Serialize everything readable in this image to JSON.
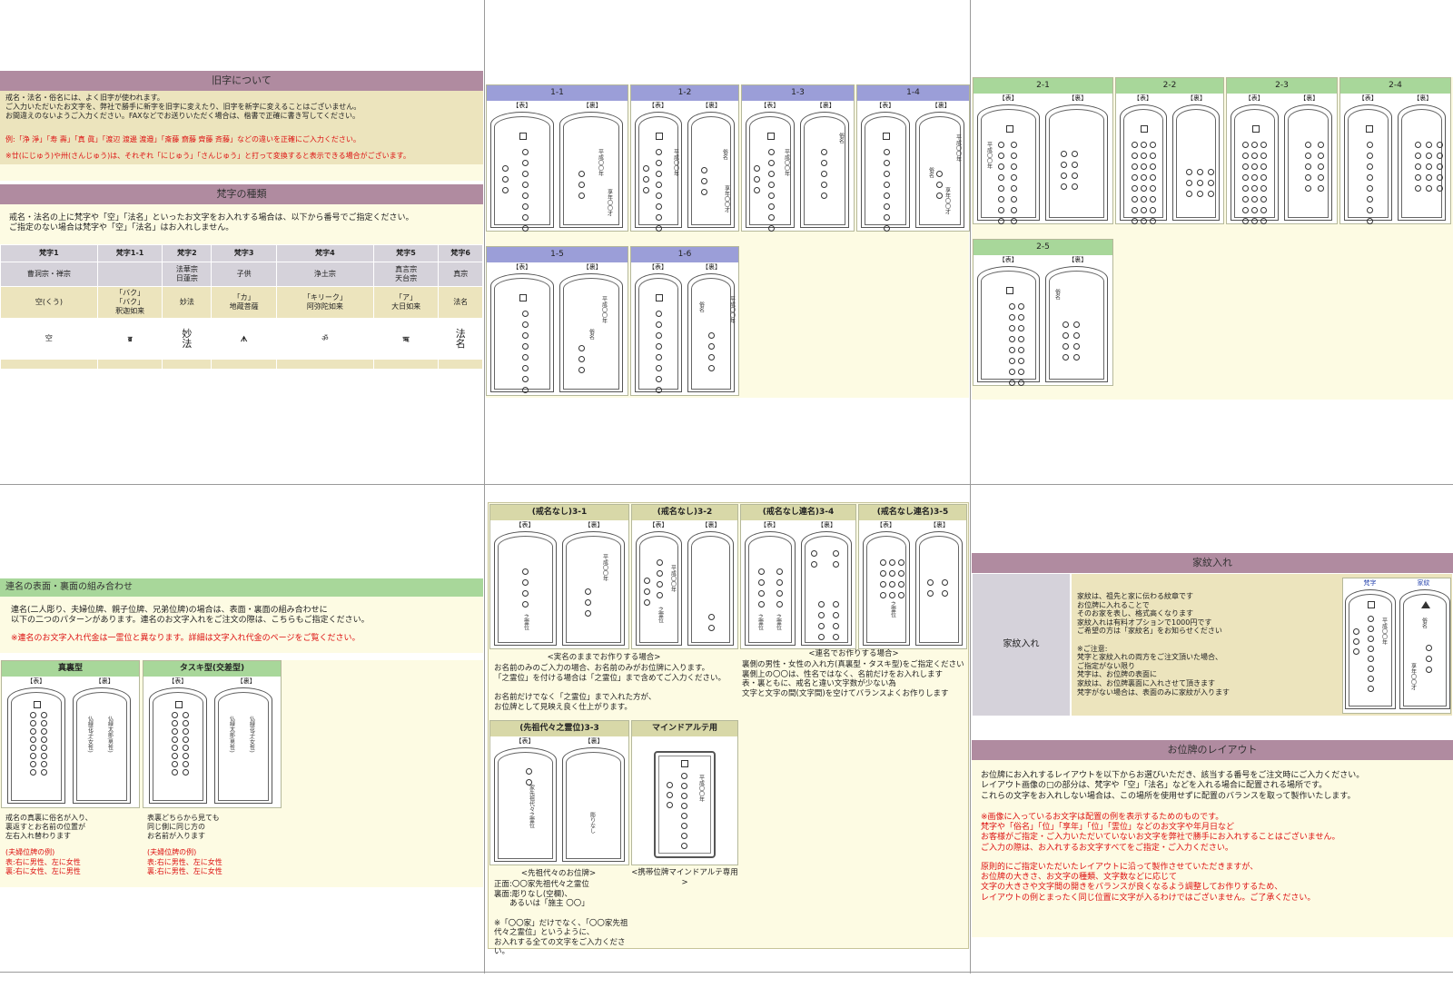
{
  "kyuji": {
    "title": "旧字について",
    "lines": [
      "戒名・法名・俗名には、よく旧字が使われます。",
      "ご入力いただいたお文字を、弊社で勝手に新字を旧字に変えたり、旧字を新字に変えることはございません。",
      "お間違えのないようご入力ください。FAXなどでお送りいただく場合は、楷書で正確に書き写してください。"
    ],
    "red1": "例:「浄 淨」「寿 壽」「真 眞」「渡辺 渡邊 渡邉」「斎藤 齋藤 齊藤 斉藤」などの違いを正確にご入力ください。",
    "red2": "※廿(にじゅう)や卅(さんじゅう)は、それぞれ「にじゅう」「さんじゅう」と打って変換すると表示できる場合がございます。"
  },
  "bonji": {
    "title": "梵字の種類",
    "intro": "戒名・法名の上に梵字や「空」「法名」といったお文字をお入れする場合は、以下から番号でご指定ください。\nご指定のない場合は梵字や「空」「法名」はお入れしません。",
    "headers": [
      "梵字1",
      "梵字1-1",
      "梵字2",
      "梵字3",
      "梵字4",
      "梵字5",
      "梵字6"
    ],
    "sects": [
      "曹洞宗・禅宗",
      "",
      "法華宗\n日蓮宗",
      "子供",
      "浄土宗",
      "真言宗\n天台宗",
      "真宗"
    ],
    "names": [
      "空(くう)",
      "「バク」\n「バク」\n釈迦如来",
      "妙法",
      "「カ」\n地蔵菩薩",
      "「キリーク」\n阿弥陀如来",
      "「ア」\n大日如来",
      "法名"
    ],
    "glyphs": [
      "空",
      "ॿ",
      "妙\n法",
      "ᗑ",
      "ॐ",
      "ऋ",
      "法\n名"
    ]
  },
  "tablet_labels": {
    "front": "【表】",
    "back": "【裏】"
  },
  "tablet_text": {
    "heisei": "平成〇〇年",
    "month_day": "〇〇月〇〇日",
    "zokumyo": "俗名",
    "kyonen": "享年〇〇才",
    "ieshi": "家先祖代々之霊位",
    "horinuki": "彫りなし",
    "reii": "之霊位"
  },
  "layout1": [
    "1-1",
    "1-2",
    "1-3",
    "1-4",
    "1-5",
    "1-6"
  ],
  "layout2": [
    "2-1",
    "2-2",
    "2-3",
    "2-4",
    "2-5"
  ],
  "renmei": {
    "title": "連名の表面・裏面の組み合わせ",
    "intro": "連名(二人彫り、夫婦位牌、親子位牌、兄弟位牌)の場合は、表面・裏面の組み合わせに\n以下の二つのパターンがあります。連名のお文字入れをご注文の際は、こちらもご指定ください。",
    "red": "※連名のお文字入れ代金は一霊位と異なります。詳細は文字入れ代金のページをご覧ください。",
    "type1": "真裏型",
    "type2": "タスキ型(交差型)",
    "desc1": "戒名の真裏に俗名が入り、\n裏返すとお名前の位置が\n左右入れ替わります",
    "desc2": "表裏どちらから見ても\n同じ側に同じ方の\nお名前が入ります",
    "ex1_title": "(夫婦位牌の例)",
    "ex1": "表:右に男性、左に女性\n裏:右に女性、左に男性",
    "ex2_title": "(夫婦位牌の例)",
    "ex2": "表:右に男性、左に女性\n裏:右に男性、左に女性",
    "name_a": "仏緑花子(女性)",
    "name_b": "仏緑太郎(男性)"
  },
  "kaimyo_nashi": {
    "l31": "(戒名なし)3-1",
    "l32": "(戒名なし)3-2",
    "l34": "(戒名なし連名)3-4",
    "l35": "(戒名なし連名)3-5",
    "l33": "(先祖代々之霊位)3-3",
    "mind": "マインドアルテ用",
    "cap1": "<実名のままでお作りする場合>",
    "cap1_text": "お名前のみのご入力の場合、お名前のみがお位牌に入ります。\n「之霊位」を付ける場合は「之霊位」まで含めてご入力ください。\n\nお名前だけでなく「之霊位」まで入れた方が、\nお位牌として見映え良く仕上がります。",
    "cap2": "<連名でお作りする場合>",
    "cap2_text": "裏側の男性・女性の入れ方(真裏型・タスキ型)をご指定ください\n裏側上の〇〇は、性名ではなく、名前だけをお入れします\n表・裏ともに、戒名と違い文字数が少ない為\n文字と文字の間(文字間)を空けてバランスよくお作りします",
    "cap3": "<先祖代々のお位牌>",
    "cap3_text": "正面:〇〇家先祖代々之霊位\n裏面:彫りなし(空欄)、\n　　あるいは「施主 〇〇」\n\n※「〇〇家」だけでなく、「〇〇家先祖\n代々之霊位」というように、\nお入れする全ての文字をご入力くださ\nい。",
    "cap4": "<携帯位牌マインドアルテ専用>"
  },
  "kamon": {
    "title": "家紋入れ",
    "label": "家紋入れ",
    "text": "家紋は、祖先と家に伝わる紋章です\nお位牌に入れることで\nそのお家を表し、格式高くなります\n家紋入れは有料オプションで1000円です\nご希望の方は「家紋名」をお知らせください\n\n※ご注意:\n梵字と家紋入れの両方をご注文頂いた場合、\nご指定がない限り\n梵字は、お位牌の表面に\n家紋は、お位牌裏面に入れさせて頂きます\n梵字がない場合は、表面のみに家紋が入ります",
    "bonji_lbl": "梵字",
    "kamon_lbl": "家紋"
  },
  "layout": {
    "title": "お位牌のレイアウト",
    "text": "お位牌にお入れするレイアウトを以下からお選びいただき、該当する番号をご注文時にご入力ください。\nレイアウト画像の□の部分は、梵字や「空」「法名」などを入れる場合に配置される場所です。\nこれらの文字をお入れしない場合は、この場所を使用せずに配置のバランスを取って製作いたします。",
    "red1": "※画像に入っているお文字は配置の例を表示するためのものです。\n梵字や「俗名」「位」「享年」「位」「霊位」などのお文字や年月日など\nお客様がご指定・ご入力いただいていないお文字を弊社で勝手にお入れすることはございません。\nご入力の際は、お入れするお文字すべてをご指定・ご入力ください。",
    "red2": "原則的にご指定いただいたレイアウトに沿って製作させていただきますが、\nお位牌の大きさ、お文字の種類、文字数などに応じて\n文字の大きさや文字間の開きをバランスが良くなるよう調整してお作りするため、\nレイアウトの例とまったく同じ位置に文字が入るわけではございません。ご了承ください。"
  }
}
